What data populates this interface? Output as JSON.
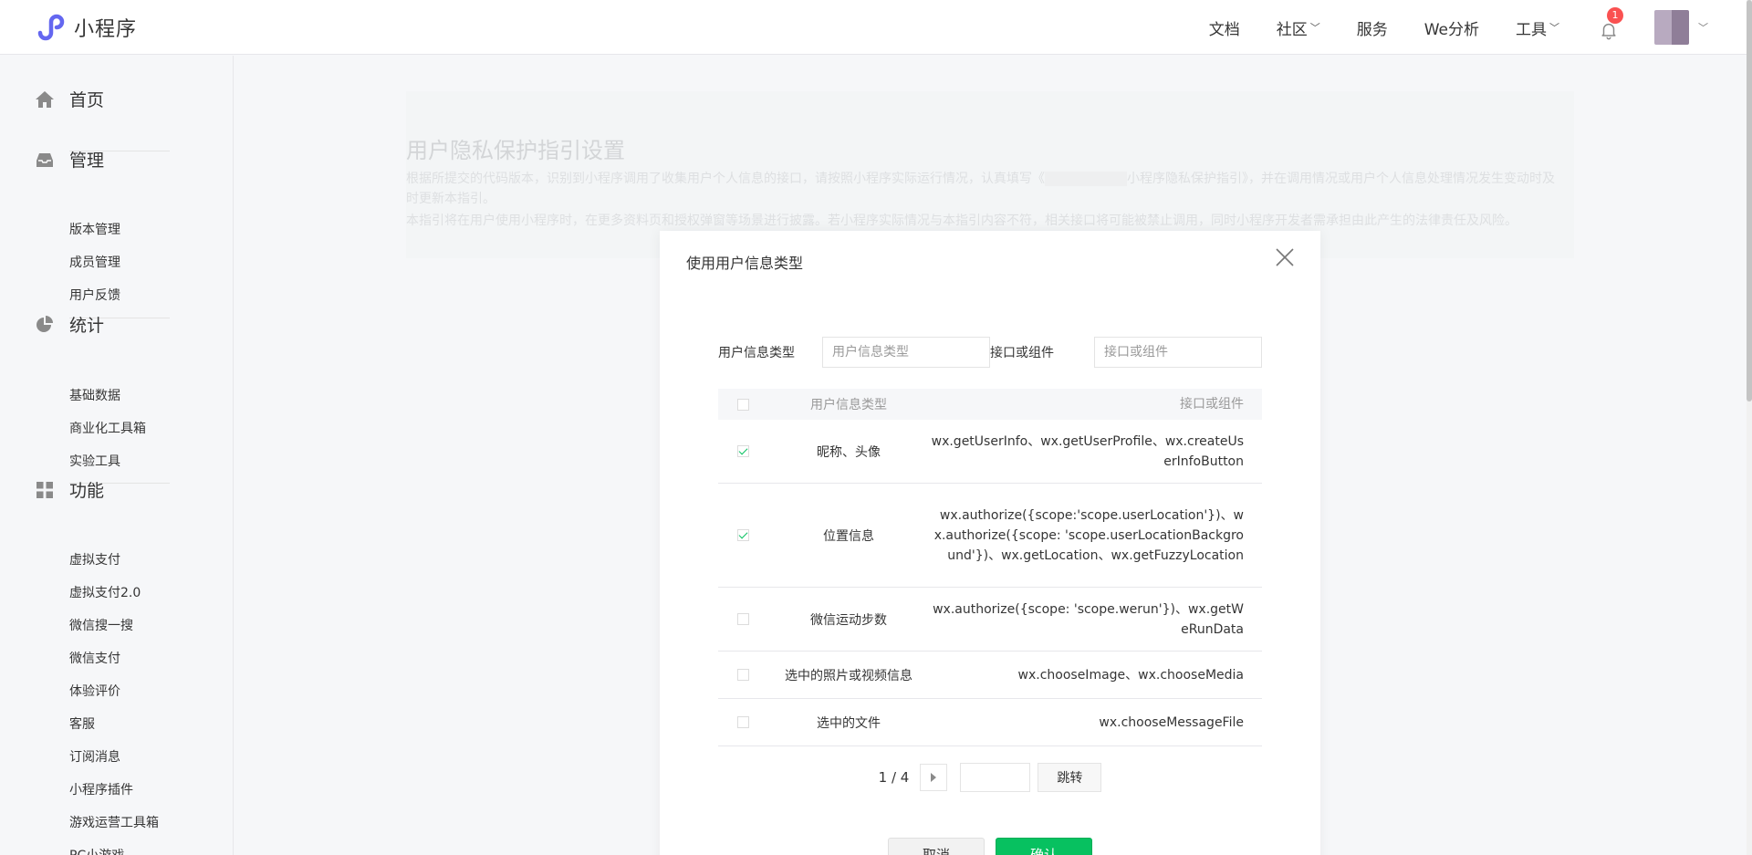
{
  "app": {
    "title": "小程序"
  },
  "topnav": {
    "items": [
      {
        "label": "文档",
        "has_dropdown": false
      },
      {
        "label": "社区",
        "has_dropdown": true
      },
      {
        "label": "服务",
        "has_dropdown": false
      },
      {
        "label": "We分析",
        "has_dropdown": false
      },
      {
        "label": "工具",
        "has_dropdown": true
      }
    ],
    "notification_count": "1"
  },
  "sidebar": {
    "sections": [
      {
        "label": "首页",
        "icon": "home-icon",
        "items": []
      },
      {
        "label": "管理",
        "icon": "inbox-icon",
        "items": [
          "版本管理",
          "成员管理",
          "用户反馈"
        ]
      },
      {
        "label": "统计",
        "icon": "pie-chart-icon",
        "items": [
          "基础数据",
          "商业化工具箱",
          "实验工具"
        ]
      },
      {
        "label": "功能",
        "icon": "grid-icon",
        "items": [
          "虚拟支付",
          "虚拟支付2.0",
          "微信搜一搜",
          "微信支付",
          "体验评价",
          "客服",
          "订阅消息",
          "小程序插件",
          "游戏运营工具箱",
          "PC小游戏"
        ]
      }
    ]
  },
  "page": {
    "title": "用户隐私保护指引设置",
    "desc_line1a": "根据所提交的代码版本，识别到小程序调用了收集用户个人信息的接口，请按照小程序实际运行情况，认真填写《",
    "desc_line1b": "小程序隐私保护指引》，并在调用情况或用户个人信息处理情况发生变动时及",
    "desc_line2": "时更新本指引。",
    "desc_line3": "本指引将在用户使用小程序时，在更多资料页和授权弹窗等场景进行披露。若小程序实际情况与本指引内容不符，相关接口将可能被禁止调用，同时小程序开发者需承担由此产生的法律责任及风险。"
  },
  "dialog": {
    "title": "使用用户信息类型",
    "filter_type_label": "用户信息类型",
    "filter_type_placeholder": "用户信息类型",
    "filter_api_label": "接口或组件",
    "filter_api_placeholder": "接口或组件",
    "columns": {
      "type": "用户信息类型",
      "api": "接口或组件"
    },
    "rows": [
      {
        "type": "昵称、头像",
        "api": "wx.getUserInfo、wx.getUserProfile、wx.createUserInfoButton",
        "checked": true
      },
      {
        "type": "位置信息",
        "api": "wx.authorize({scope:'scope.userLocation'})、wx.authorize({scope: 'scope.userLocationBackground'})、wx.getLocation、wx.getFuzzyLocation",
        "checked": true
      },
      {
        "type": "微信运动步数",
        "api": "wx.authorize({scope: 'scope.werun'})、wx.getWeRunData",
        "checked": false
      },
      {
        "type": "选中的照片或视频信息",
        "api": "wx.chooseImage、wx.chooseMedia",
        "checked": false
      },
      {
        "type": "选中的文件",
        "api": "wx.chooseMessageFile",
        "checked": false
      }
    ],
    "pager": {
      "text": "1 / 4",
      "go_label": "跳转"
    },
    "cancel_label": "取消",
    "confirm_label": "确认"
  },
  "colors": {
    "accent": "#07c160",
    "badge": "#fa5151",
    "logo": "#6467f0"
  }
}
